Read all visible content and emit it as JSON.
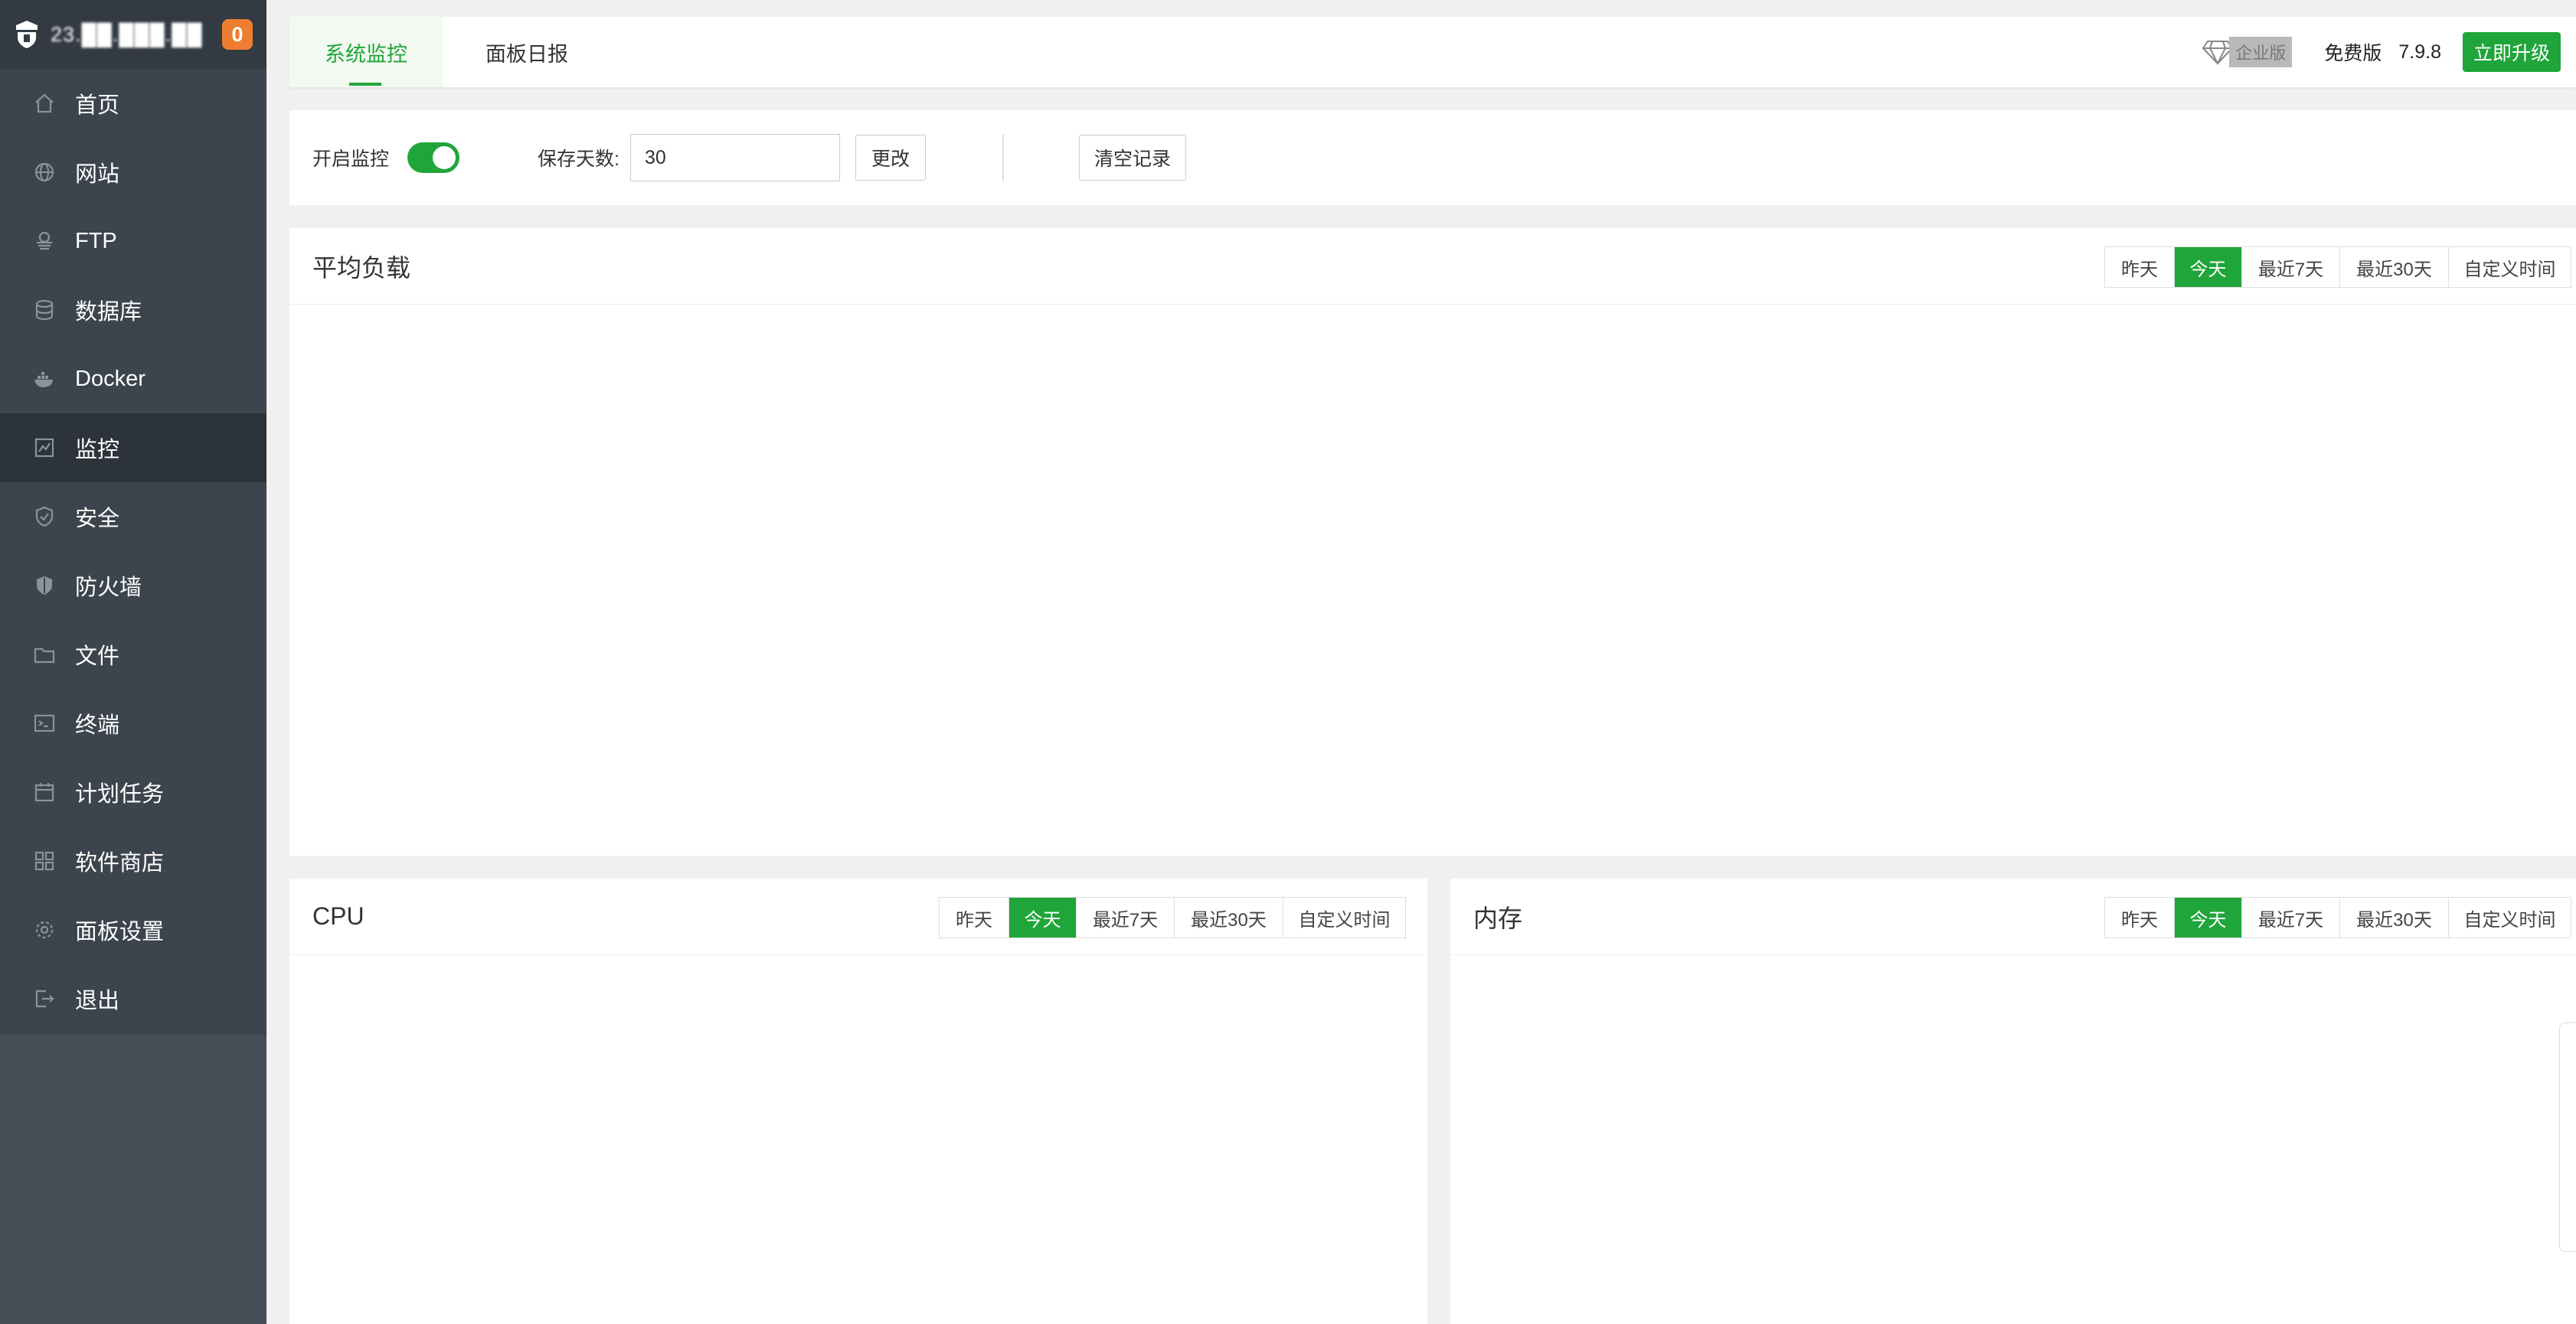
{
  "sidebar": {
    "server_name": "23.██.███.██",
    "notification_count": "0",
    "items": [
      {
        "label": "首页",
        "icon": "home-icon"
      },
      {
        "label": "网站",
        "icon": "globe-icon"
      },
      {
        "label": "FTP",
        "icon": "ftp-icon"
      },
      {
        "label": "数据库",
        "icon": "database-icon"
      },
      {
        "label": "Docker",
        "icon": "docker-icon"
      },
      {
        "label": "监控",
        "icon": "monitor-icon",
        "active": true
      },
      {
        "label": "安全",
        "icon": "shield-icon"
      },
      {
        "label": "防火墙",
        "icon": "firewall-icon"
      },
      {
        "label": "文件",
        "icon": "folder-icon"
      },
      {
        "label": "终端",
        "icon": "terminal-icon"
      },
      {
        "label": "计划任务",
        "icon": "calendar-icon"
      },
      {
        "label": "软件商店",
        "icon": "apps-icon"
      },
      {
        "label": "面板设置",
        "icon": "gear-icon"
      },
      {
        "label": "退出",
        "icon": "logout-icon"
      }
    ]
  },
  "header": {
    "tabs": [
      {
        "label": "系统监控",
        "active": true
      },
      {
        "label": "面板日报"
      }
    ],
    "enterprise_label": "企业版",
    "free_label": "免费版",
    "version": "7.9.8",
    "upgrade_label": "立即升级"
  },
  "settings": {
    "monitor_label": "开启监控",
    "monitor_enabled": true,
    "save_days_label": "保存天数:",
    "save_days_value": "30",
    "change_label": "更改",
    "clear_label": "清空记录"
  },
  "ranges": [
    "昨天",
    "今天",
    "最近7天",
    "最近30天",
    "自定义时间"
  ],
  "active_range": "今天",
  "panels": {
    "load": {
      "title": "平均负载"
    },
    "cpu": {
      "title": "CPU"
    },
    "memory": {
      "title": "内存"
    }
  },
  "colors": {
    "accent": "#20a53a",
    "sidebar": "#3c444d",
    "badge": "#ef7d31"
  }
}
